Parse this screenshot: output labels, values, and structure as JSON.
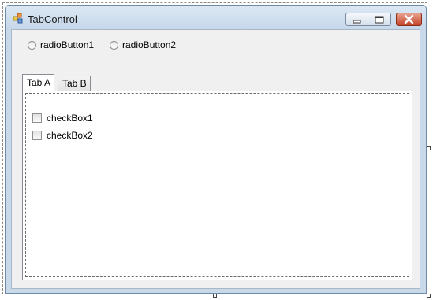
{
  "window": {
    "title": "TabControl",
    "icon": "winforms-app-icon"
  },
  "title_bar": {
    "buttons": [
      "minimize",
      "maximize",
      "close"
    ]
  },
  "radios": [
    {
      "label": "radioButton1",
      "checked": false
    },
    {
      "label": "radioButton2",
      "checked": false
    }
  ],
  "tabs": [
    {
      "label": "Tab A",
      "selected": true
    },
    {
      "label": "Tab B",
      "selected": false
    }
  ],
  "tab_a": {
    "checkboxes": [
      {
        "label": "checkBox1",
        "checked": false
      },
      {
        "label": "checkBox2",
        "checked": false
      }
    ]
  },
  "colors": {
    "titlebar": "#c9d9ea",
    "client_background": "#f0f0f0",
    "close_button": "#c5462b"
  }
}
